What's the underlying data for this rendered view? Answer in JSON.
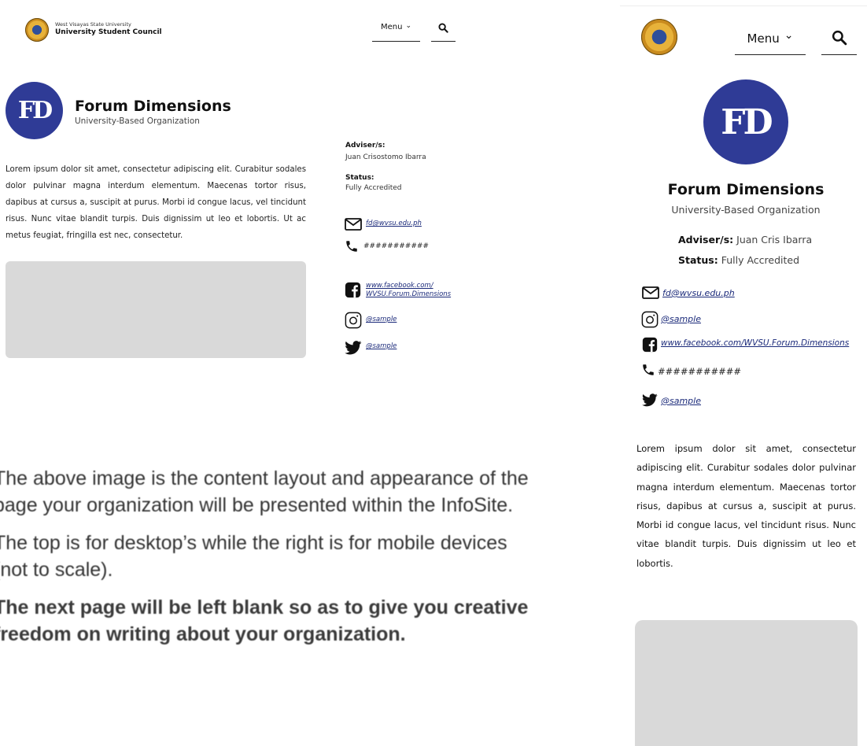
{
  "desktop": {
    "header": {
      "university": "West Visayas State University",
      "council": "University Student Council",
      "menu_label": "Menu",
      "chevron_glyph": "⌄"
    },
    "org": {
      "logo_text": "FD",
      "name": "Forum Dimensions",
      "type": "University-Based Organization",
      "description": "Lorem ipsum dolor sit amet, consectetur adipiscing elit. Curabitur sodales dolor pulvinar magna interdum elementum. Maecenas tortor risus, dapibus at cursus a, suscipit at purus. Morbi id congue lacus, vel tincidunt risus. Nunc vitae blandit turpis. Duis dignissim ut leo et lobortis. Ut ac metus feugiat, fringilla est nec, consectetur."
    },
    "info": {
      "adviser_label": "Adviser/s:",
      "adviser_value": "Juan Crisostomo Ibarra",
      "status_label": "Status:",
      "status_value": "Fully Accredited"
    },
    "contacts": {
      "email": "fd@wvsu.edu.ph",
      "phone": "###########",
      "facebook_line1": "www.facebook.com/",
      "facebook_line2": "WVSU.Forum.Dimensions",
      "instagram": "@sample",
      "twitter": "@sample"
    }
  },
  "mobile": {
    "header": {
      "menu_label": "Menu",
      "chevron_glyph": "⌄"
    },
    "org": {
      "logo_text": "FD",
      "name": "Forum Dimensions",
      "type": "University-Based Organization",
      "description": "Lorem ipsum dolor sit amet, consectetur adipiscing elit. Curabitur sodales dolor pulvinar magna interdum elementum. Maecenas tortor risus, dapibus at cursus a, suscipit at purus. Morbi id congue lacus, vel tincidunt risus. Nunc vitae blandit turpis. Duis dignissim ut leo et lobortis."
    },
    "info": {
      "adviser_label": "Adviser/s:",
      "adviser_value": "Juan Cris Ibarra",
      "status_label": "Status:",
      "status_value": "Fully Accredited"
    },
    "contacts": {
      "email": "fd@wvsu.edu.ph",
      "instagram": "@sample",
      "facebook": "www.facebook.com/WVSU.Forum.Dimensions",
      "phone": "###########",
      "twitter": "@sample"
    }
  },
  "notes": {
    "p1": "The above image is the content layout and appearance of the page your organization will be presented within the InfoSite.",
    "p2": "The top is for desktop’s while the right is for mobile devices (not to scale).",
    "p3": "The next page will be left blank so as to give you creative freedom on writing about your organization."
  },
  "colors": {
    "brand_blue": "#2f3b96",
    "link": "#1b2a7a",
    "placeholder": "#d9d9d9"
  },
  "icons": [
    "university-seal-icon",
    "chevron-down-icon",
    "search-icon",
    "mail-icon",
    "phone-icon",
    "facebook-icon",
    "instagram-icon",
    "twitter-icon"
  ]
}
